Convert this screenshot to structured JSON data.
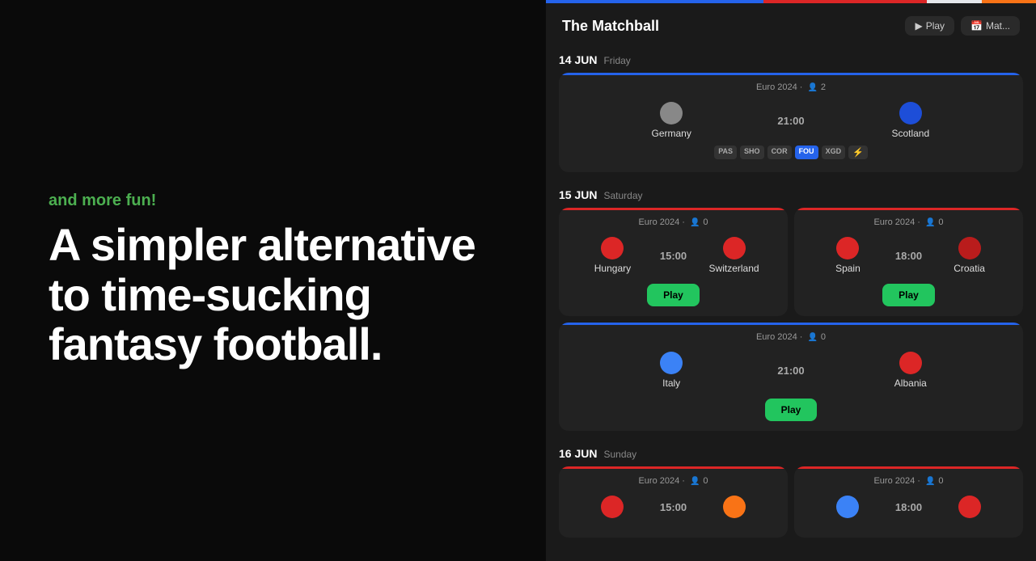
{
  "left": {
    "tagline": "and more fun!",
    "headline": "A simpler alternative to time-sucking fantasy football."
  },
  "app": {
    "title": "The Matchball",
    "buttons": [
      {
        "id": "play-btn",
        "label": "Play",
        "icon": "▶"
      },
      {
        "id": "match-btn",
        "label": "Mat...",
        "icon": "📅"
      }
    ]
  },
  "dates": [
    {
      "date": "14 JUN",
      "weekday": "Friday",
      "matches": [
        {
          "id": "germany-scotland",
          "competition": "Euro 2024",
          "participants": "2",
          "accent": "blue",
          "team1": {
            "name": "Germany",
            "color": "dot-gray"
          },
          "team2": {
            "name": "Scotland",
            "color": "dot-blue"
          },
          "time": "21:00",
          "tags": [
            "PAS",
            "SHO",
            "COR",
            "FOU",
            "XGD",
            "⚡"
          ],
          "activeTag": "FOU",
          "hasPlay": false
        }
      ]
    },
    {
      "date": "15 JUN",
      "weekday": "Saturday",
      "matches": [
        {
          "id": "hungary-switzerland",
          "competition": "Euro 2024",
          "participants": "0",
          "accent": "red",
          "team1": {
            "name": "Hungary",
            "color": "dot-red"
          },
          "team2": {
            "name": "Switzerland",
            "color": "dot-red"
          },
          "time": "15:00",
          "hasPlay": true
        },
        {
          "id": "spain-croatia",
          "competition": "Euro 2024",
          "participants": "0",
          "accent": "red",
          "team1": {
            "name": "Spain",
            "color": "dot-red"
          },
          "team2": {
            "name": "Croatia",
            "color": "dot-dark-red"
          },
          "time": "18:00",
          "hasPlay": true
        }
      ]
    },
    {
      "date": "15 JUN",
      "weekday": "Saturday",
      "matches": [
        {
          "id": "italy-albania",
          "competition": "Euro 2024",
          "participants": "0",
          "accent": "blue",
          "team1": {
            "name": "Italy",
            "color": "dot-light-blue"
          },
          "team2": {
            "name": "Albania",
            "color": "dot-red"
          },
          "time": "21:00",
          "hasPlay": true
        }
      ]
    },
    {
      "date": "16 JUN",
      "weekday": "Sunday",
      "matches": [
        {
          "id": "match-16a",
          "competition": "Euro 2024",
          "participants": "0",
          "accent": "red",
          "team1": {
            "name": "",
            "color": "dot-red"
          },
          "team2": {
            "name": "",
            "color": "dot-orange"
          },
          "time": "15:00",
          "hasPlay": false
        },
        {
          "id": "match-16b",
          "competition": "Euro 2024",
          "participants": "0",
          "accent": "red",
          "team1": {
            "name": "",
            "color": "dot-light-blue"
          },
          "team2": {
            "name": "",
            "color": "dot-red"
          },
          "time": "18:00",
          "hasPlay": false
        }
      ]
    }
  ]
}
